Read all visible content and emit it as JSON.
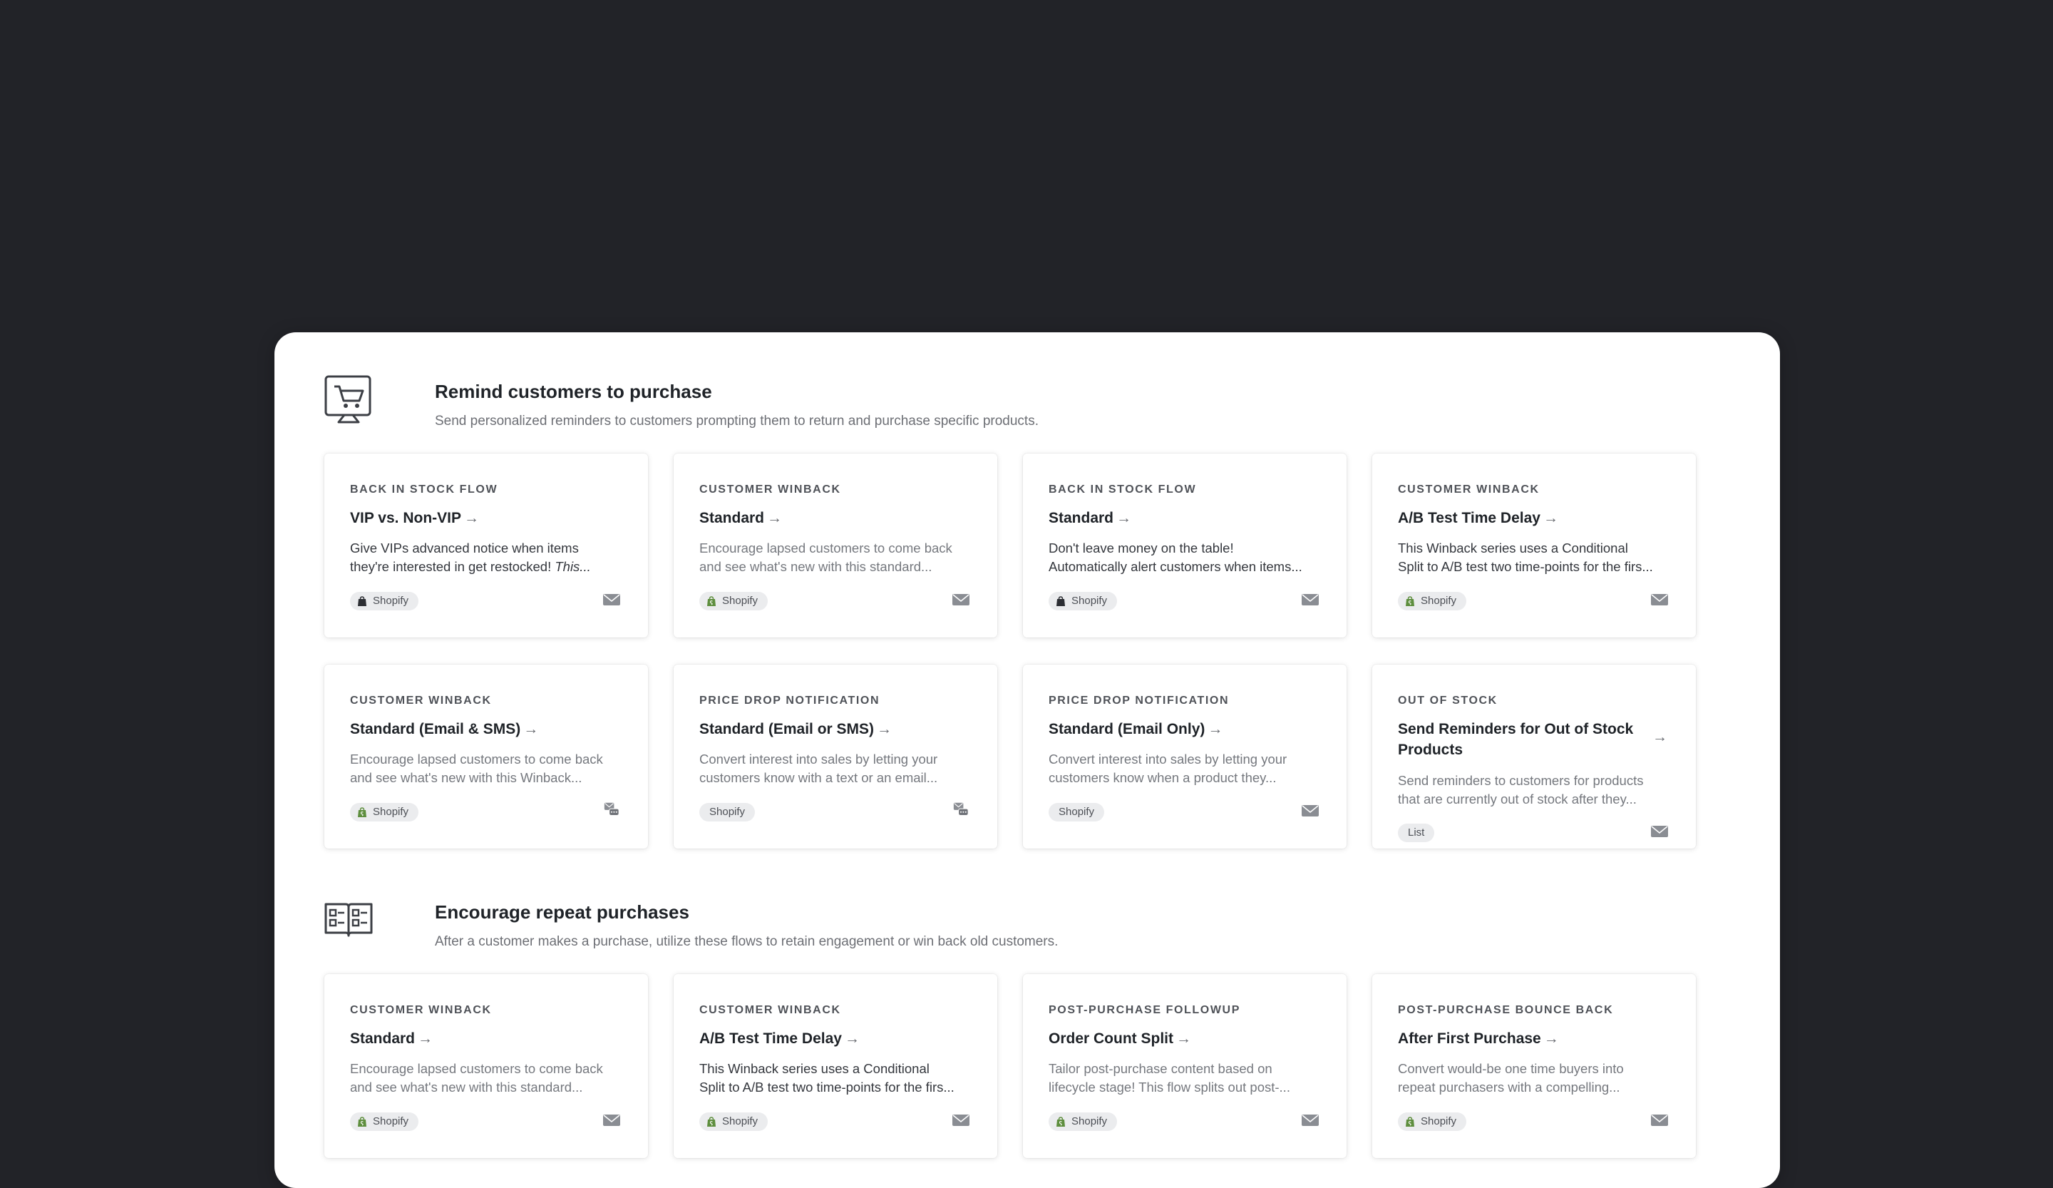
{
  "colors": {
    "background": "#222328",
    "panel": "#ffffff",
    "shopify_green": "#5e8e3e",
    "muted_text": "#75787e"
  },
  "sections": [
    {
      "title": "Remind customers to purchase",
      "description": "Send personalized reminders to customers prompting them to return and purchase specific products.",
      "icon": "shopping-cart-icon",
      "cards": [
        {
          "category": "BACK IN STOCK FLOW",
          "title": "VIP vs. Non-VIP",
          "desc1": "Give VIPs advanced notice when items",
          "desc2": "they're interested in get restocked! ",
          "desc2_em": "This...",
          "tag": "Shopify",
          "tag_icon": "shopify-bag-dark-icon",
          "channel": "email-icon"
        },
        {
          "category": "CUSTOMER WINBACK",
          "title": "Standard",
          "desc1": "Encourage lapsed customers to come back",
          "desc2": "and see what's new with this standard...",
          "tag": "Shopify",
          "tag_icon": "shopify-bag-icon",
          "channel": "email-icon"
        },
        {
          "category": "BACK IN STOCK FLOW",
          "title": "Standard",
          "desc1": "Don't leave money on the table!",
          "desc2": "Automatically alert customers when items...",
          "tag": "Shopify",
          "tag_icon": "shopify-bag-dark-icon",
          "channel": "email-icon"
        },
        {
          "category": "CUSTOMER WINBACK",
          "title": "A/B Test Time Delay",
          "desc1": "This Winback series uses a Conditional",
          "desc2": "Split to A/B test two time-points for the firs...",
          "tag": "Shopify",
          "tag_icon": "shopify-bag-icon",
          "channel": "email-icon"
        },
        {
          "category": "CUSTOMER WINBACK",
          "title": "Standard (Email & SMS)",
          "desc1": "Encourage lapsed customers to come back",
          "desc2": "and see what's new with this Winback...",
          "tag": "Shopify",
          "tag_icon": "shopify-bag-icon",
          "channel": "email-sms-icon"
        },
        {
          "category": "PRICE DROP NOTIFICATION",
          "title": "Standard (Email or SMS)",
          "desc1": "Convert interest into sales by letting your",
          "desc2": "customers know with a text or an email...",
          "tag": "Shopify",
          "tag_icon": "",
          "channel": "email-sms-icon"
        },
        {
          "category": "PRICE DROP NOTIFICATION",
          "title": "Standard (Email Only)",
          "desc1": "Convert interest into sales by letting your",
          "desc2": "customers know when a product they...",
          "tag": "Shopify",
          "tag_icon": "",
          "channel": "email-icon"
        },
        {
          "category": "OUT OF STOCK",
          "title": "Send Reminders for Out of Stock Products",
          "desc1": "Send reminders to customers for products",
          "desc2": "that are currently out of stock after they...",
          "tag": "List",
          "tag_icon": "",
          "channel": "email-icon"
        }
      ]
    },
    {
      "title": "Encourage repeat purchases",
      "description": "After a customer makes a purchase, utilize these flows to retain engagement or win back old customers.",
      "icon": "catalog-icon",
      "cards": [
        {
          "category": "CUSTOMER WINBACK",
          "title": "Standard",
          "desc1": "Encourage lapsed customers to come back",
          "desc2": "and see what's new with this standard...",
          "tag": "Shopify",
          "tag_icon": "shopify-bag-icon",
          "channel": "email-icon"
        },
        {
          "category": "CUSTOMER WINBACK",
          "title": "A/B Test Time Delay",
          "desc1": "This Winback series uses a Conditional",
          "desc2": "Split to A/B test two time-points for the firs...",
          "tag": "Shopify",
          "tag_icon": "shopify-bag-icon",
          "channel": "email-icon"
        },
        {
          "category": "POST-PURCHASE FOLLOWUP",
          "title": "Order Count Split",
          "desc1": "Tailor post-purchase content based on",
          "desc2": "lifecycle stage! This flow splits out post-...",
          "tag": "Shopify",
          "tag_icon": "shopify-bag-icon",
          "channel": "email-icon"
        },
        {
          "category": "POST-PURCHASE BOUNCE BACK",
          "title": "After First Purchase",
          "desc1": "Convert would-be one time buyers into",
          "desc2": "repeat purchasers with a compelling...",
          "tag": "Shopify",
          "tag_icon": "shopify-bag-icon",
          "channel": "email-icon"
        }
      ]
    }
  ]
}
